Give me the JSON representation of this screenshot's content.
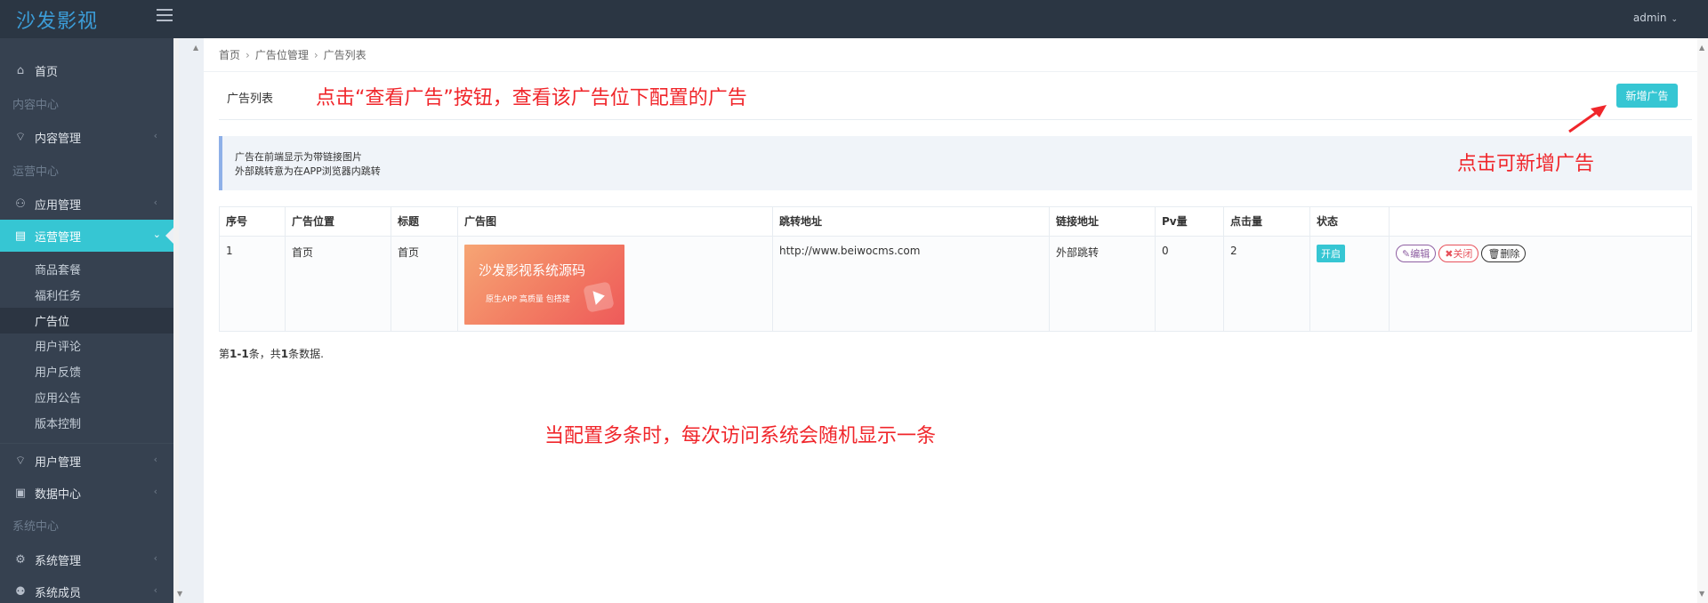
{
  "app": {
    "logo": "沙发影视",
    "user": "admin"
  },
  "sidebar": {
    "home": "首页",
    "sections": [
      "内容中心",
      "运营中心",
      "系统中心"
    ],
    "items": [
      {
        "label": "内容管理",
        "icon": "tag-icon"
      },
      {
        "label": "应用管理",
        "icon": "user-icon"
      },
      {
        "label": "运营管理",
        "icon": "book-icon"
      },
      {
        "label": "用户管理",
        "icon": "tag-icon"
      },
      {
        "label": "数据中心",
        "icon": "clipboard-icon"
      },
      {
        "label": "系统管理",
        "icon": "gear-icon"
      },
      {
        "label": "系统成员",
        "icon": "users-icon"
      }
    ],
    "sub_items": [
      "商品套餐",
      "福利任务",
      "广告位",
      "用户评论",
      "用户反馈",
      "应用公告",
      "版本控制"
    ]
  },
  "breadcrumb": [
    "首页",
    "广告位管理",
    "广告列表"
  ],
  "panel": {
    "title": "广告列表",
    "add_button": "新增广告"
  },
  "note": {
    "line1": "广告在前端显示为带链接图片",
    "line2": "外部跳转意为在APP浏览器内跳转"
  },
  "table": {
    "headers": [
      "序号",
      "广告位置",
      "标题",
      "广告图",
      "跳转地址",
      "链接地址",
      "Pv量",
      "点击量",
      "状态",
      ""
    ],
    "rows": [
      {
        "id": "1",
        "position": "首页",
        "title": "首页",
        "image_text": "沙发影视系统源码",
        "image_sub": "原生APP  高质量  包搭建",
        "url": "http://www.beiwocms.com",
        "link": "外部跳转",
        "pv": "0",
        "clicks": "2",
        "status": "开启",
        "ops": {
          "edit": "编辑",
          "close": "关闭",
          "delete": "删除"
        }
      }
    ]
  },
  "summary": {
    "prefix": "第",
    "range": "1-1",
    "mid": "条，共",
    "total": "1",
    "suffix": "条数据."
  },
  "annotations": {
    "view_ads": "点击“查看广告”按钮，查看该广告位下配置的广告",
    "add_ad": "点击可新增广告",
    "random": "当配置多条时，每次访问系统会随机显示一条"
  },
  "colors": {
    "accent": "#36c6d3",
    "annotation": "#f0262b",
    "sidebar": "#364150",
    "topbar": "#2b3643"
  }
}
